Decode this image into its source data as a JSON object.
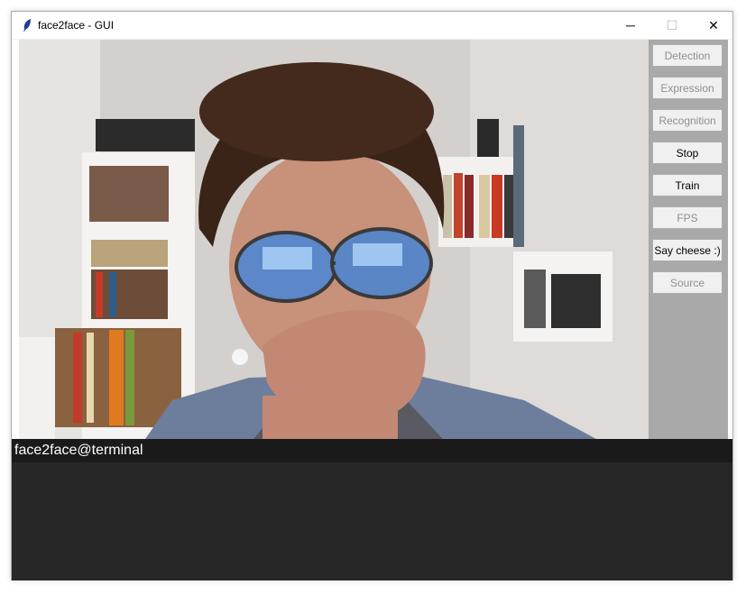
{
  "window": {
    "title": "face2face - GUI",
    "controls": {
      "minimize": "─",
      "maximize": "☐",
      "close": "✕"
    }
  },
  "video": {
    "content": "webcam-feed"
  },
  "sidebar": {
    "buttons": [
      {
        "label": "Detection",
        "enabled": false
      },
      {
        "label": "Expression",
        "enabled": false
      },
      {
        "label": "Recognition",
        "enabled": false
      },
      {
        "label": "Stop",
        "enabled": true
      },
      {
        "label": "Train",
        "enabled": true
      },
      {
        "label": "FPS",
        "enabled": false
      },
      {
        "label": "Say cheese :)",
        "enabled": true
      },
      {
        "label": "Source",
        "enabled": false
      }
    ]
  },
  "terminal": {
    "prompt": "face2face@terminal"
  },
  "colors": {
    "sidebar": "#a9a9a9",
    "terminal_header": "#1a1a1a",
    "terminal_body": "#272727",
    "disabled_text": "#8f8f8f"
  }
}
